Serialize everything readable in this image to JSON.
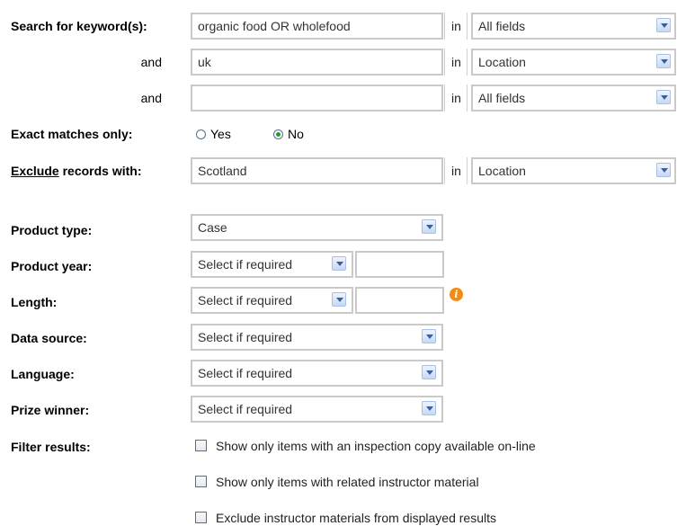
{
  "search": {
    "label": "Search for keyword(s):",
    "rows": [
      {
        "connector": "",
        "value": "organic food OR wholefood",
        "in": "in",
        "field": "All fields"
      },
      {
        "connector": "and",
        "value": "uk",
        "in": "in",
        "field": "Location"
      },
      {
        "connector": "and",
        "value": "",
        "in": "in",
        "field": "All fields"
      }
    ]
  },
  "exact": {
    "label": "Exact matches only:",
    "options": [
      {
        "label": "Yes",
        "selected": false
      },
      {
        "label": "No",
        "selected": true
      }
    ]
  },
  "exclude": {
    "label_prefix": "Exclude",
    "label_suffix": " records with:",
    "value": "Scotland",
    "in": "in",
    "field": "Location"
  },
  "product_type": {
    "label": "Product type:",
    "value": "Case"
  },
  "product_year": {
    "label": "Product year:",
    "value": "Select if required",
    "extra": ""
  },
  "length": {
    "label": "Length:",
    "value": "Select if required",
    "extra": "",
    "info_icon": "info-icon"
  },
  "data_source": {
    "label": "Data source:",
    "value": "Select if required"
  },
  "language": {
    "label": "Language:",
    "value": "Select if required"
  },
  "prize_winner": {
    "label": "Prize winner:",
    "value": "Select if required"
  },
  "filter": {
    "label": "Filter results:",
    "options": [
      {
        "label": "Show only items with an inspection copy available on-line",
        "checked": false
      },
      {
        "label": "Show only items with related instructor material",
        "checked": false
      },
      {
        "label": "Exclude instructor materials from displayed results",
        "checked": false
      }
    ]
  },
  "colors": {
    "border": "#c9c9c9",
    "radio_selected": "#1d9d2d",
    "info": "#f08b16"
  }
}
